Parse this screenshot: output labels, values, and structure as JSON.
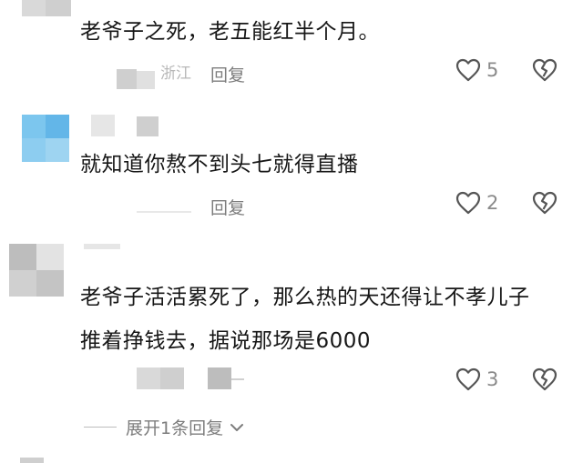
{
  "comments": [
    {
      "text_lines": [
        "老爷子之死，老五能红半个月。"
      ],
      "location_text": "浙江",
      "reply_label": "回复",
      "likes": "5"
    },
    {
      "text_lines": [
        "就知道你熬不到头七就得直播"
      ],
      "reply_label": "回复",
      "likes": "2"
    },
    {
      "text_lines": [
        "老爷子活活累死了，那么热的天还得让不孝儿子",
        "推着挣钱去，据说那场是6000"
      ],
      "likes": "3",
      "expand_label": "展开1条回复"
    }
  ],
  "icons": {
    "like": "heart-outline-icon",
    "dislike": "broken-heart-icon",
    "expand": "chevron-down-icon"
  },
  "colors": {
    "background": "#ffffff",
    "text": "#161616",
    "muted": "#8a8a8a"
  }
}
